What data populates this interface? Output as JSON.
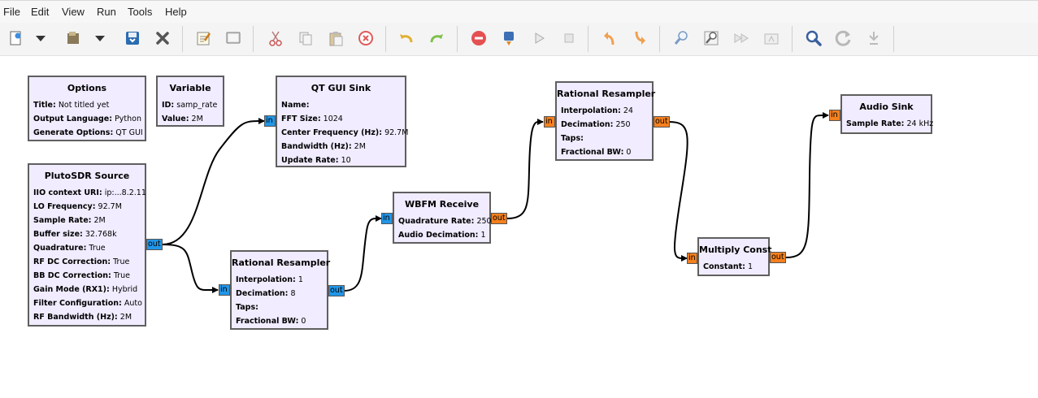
{
  "menu": [
    "File",
    "Edit",
    "View",
    "Run",
    "Tools",
    "Help"
  ],
  "toolbar": {
    "icons": [
      "new-icon",
      "dropdown-icon",
      "open-icon",
      "dropdown-icon",
      "save-icon",
      "close-icon",
      "edit-icon",
      "screen-icon",
      "cut-icon",
      "copy-icon",
      "paste-icon",
      "delete-icon",
      "undo-icon",
      "redo-icon",
      "disable-icon",
      "generate-icon",
      "execute-icon",
      "stop-icon",
      "rotate-ccw-icon",
      "rotate-cw-icon",
      "find-icon",
      "zoom-icon",
      "forward-icon",
      "print-icon",
      "search-icon",
      "reload-icon",
      "bypass-icon"
    ]
  },
  "ports": {
    "in": "in",
    "out": "out"
  },
  "colors": {
    "block_bg": "#f1ecff",
    "complex_port": "#2196e8",
    "float_port": "#f5801e"
  },
  "blocks": {
    "options": {
      "title": "Options",
      "params": [
        {
          "k": "Title:",
          "v": "Not titled yet"
        },
        {
          "k": "Output Language:",
          "v": "Python"
        },
        {
          "k": "Generate Options:",
          "v": "QT GUI"
        }
      ]
    },
    "variable": {
      "title": "Variable",
      "params": [
        {
          "k": "ID:",
          "v": "samp_rate"
        },
        {
          "k": "Value:",
          "v": "2M"
        }
      ]
    },
    "qt_gui_sink": {
      "title": "QT GUI Sink",
      "params": [
        {
          "k": "Name:",
          "v": ""
        },
        {
          "k": "FFT Size:",
          "v": "1024"
        },
        {
          "k": "Center Frequency (Hz):",
          "v": "92.7M"
        },
        {
          "k": "Bandwidth (Hz):",
          "v": "2M"
        },
        {
          "k": "Update Rate:",
          "v": "10"
        }
      ]
    },
    "pluto_source": {
      "title": "PlutoSDR Source",
      "params": [
        {
          "k": "IIO context URI:",
          "v": "ip:...8.2.11"
        },
        {
          "k": "LO Frequency:",
          "v": "92.7M"
        },
        {
          "k": "Sample Rate:",
          "v": "2M"
        },
        {
          "k": "Buffer size:",
          "v": "32.768k"
        },
        {
          "k": "Quadrature:",
          "v": "True"
        },
        {
          "k": "RF DC Correction:",
          "v": "True"
        },
        {
          "k": "BB DC Correction:",
          "v": "True"
        },
        {
          "k": "Gain Mode (RX1):",
          "v": "Hybrid"
        },
        {
          "k": "Filter Configuration:",
          "v": "Auto"
        },
        {
          "k": "RF Bandwidth (Hz):",
          "v": "2M"
        }
      ]
    },
    "resampler_1": {
      "title": "Rational Resampler",
      "params": [
        {
          "k": "Interpolation:",
          "v": "1"
        },
        {
          "k": "Decimation:",
          "v": "8"
        },
        {
          "k": "Taps:",
          "v": ""
        },
        {
          "k": "Fractional BW:",
          "v": "0"
        }
      ]
    },
    "wbfm_receive": {
      "title": "WBFM Receive",
      "params": [
        {
          "k": "Quadrature Rate:",
          "v": "250k"
        },
        {
          "k": "Audio Decimation:",
          "v": "1"
        }
      ]
    },
    "resampler_2": {
      "title": "Rational Resampler",
      "params": [
        {
          "k": "Interpolation:",
          "v": "24"
        },
        {
          "k": "Decimation:",
          "v": "250"
        },
        {
          "k": "Taps:",
          "v": ""
        },
        {
          "k": "Fractional BW:",
          "v": "0"
        }
      ]
    },
    "multiply_const": {
      "title": "Multiply Const",
      "params": [
        {
          "k": "Constant:",
          "v": "1"
        }
      ]
    },
    "audio_sink": {
      "title": "Audio Sink",
      "params": [
        {
          "k": "Sample Rate:",
          "v": "24 kHz"
        }
      ]
    }
  }
}
